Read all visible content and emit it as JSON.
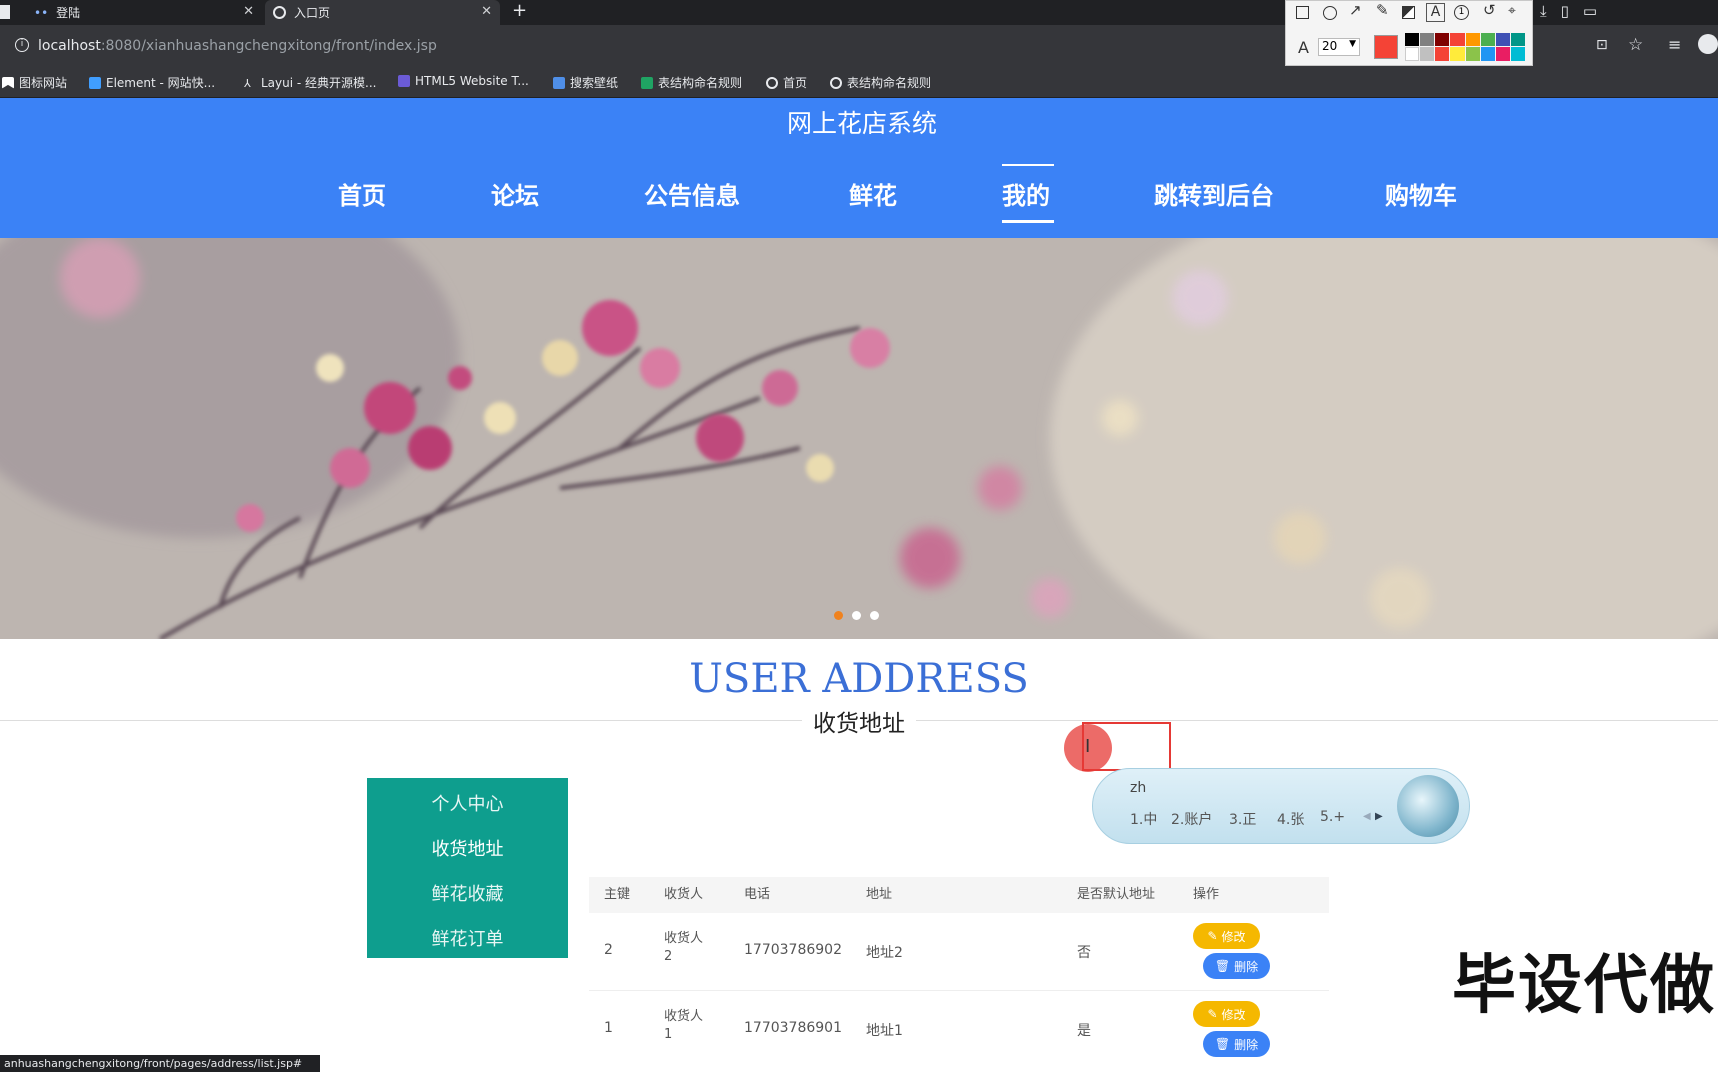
{
  "browser": {
    "tabs": [
      {
        "label": "登陆"
      },
      {
        "label": "入口页"
      }
    ],
    "new_tab": "+",
    "url_host": "localhost",
    "url_rest": ":8080/xianhuashangchengxitong/front/index.jsp",
    "bookmarks": [
      {
        "label": "图标网站",
        "icon": "bookmark-icon",
        "color": "#ffffff"
      },
      {
        "label": "Element - 网站快...",
        "icon": "element-icon",
        "color": "#409eff"
      },
      {
        "label": "Layui - 经典开源模...",
        "icon": "layui-icon",
        "color": "#e8eaed"
      },
      {
        "label": "HTML5 Website T...",
        "icon": "html5-icon",
        "color": "#6b5bd6"
      },
      {
        "label": "搜索壁纸",
        "icon": "wallpaper-icon",
        "color": "#4f8fe8"
      },
      {
        "label": "表结构命名规则",
        "icon": "sheet-icon",
        "color": "#1fa463"
      },
      {
        "label": "首页",
        "icon": "globe-icon",
        "color": "#e8eaed"
      },
      {
        "label": "表结构命名规则",
        "icon": "globe-icon",
        "color": "#e8eaed"
      }
    ],
    "status_url": "anhuashangchengxitong/front/pages/address/list.jsp#"
  },
  "annotation_toolbar": {
    "font_size": "20",
    "active_color": "#f44336"
  },
  "site": {
    "title": "网上花店系统",
    "nav": [
      "首页",
      "论坛",
      "公告信息",
      "鲜花",
      "我的",
      "跳转到后台",
      "购物车"
    ],
    "active_nav": "我的",
    "accent": "#3b82f6"
  },
  "section": {
    "title": "USER ADDRESS",
    "subtitle": "收货地址"
  },
  "sidebar": {
    "items": [
      {
        "label": "个人中心"
      },
      {
        "label": "收货地址"
      },
      {
        "label": "鲜花收藏"
      },
      {
        "label": "鲜花订单"
      }
    ],
    "color": "#0e9e8e"
  },
  "table": {
    "headers": [
      "主键",
      "收货人",
      "电话",
      "地址",
      "是否默认地址",
      "操作"
    ],
    "rows": [
      {
        "id": "2",
        "name_1": "收货人",
        "name_2": "2",
        "phone": "17703786902",
        "address": "地址2",
        "default": "否"
      },
      {
        "id": "1",
        "name_1": "收货人",
        "name_2": "1",
        "phone": "17703786901",
        "address": "地址1",
        "default": "是"
      }
    ],
    "edit_label": "修改",
    "delete_label": "删除"
  },
  "ime": {
    "input": "zh",
    "candidates": [
      "1.中",
      "2.账户",
      "3.正",
      "4.张",
      "5.+"
    ]
  },
  "watermark": "毕设代做"
}
